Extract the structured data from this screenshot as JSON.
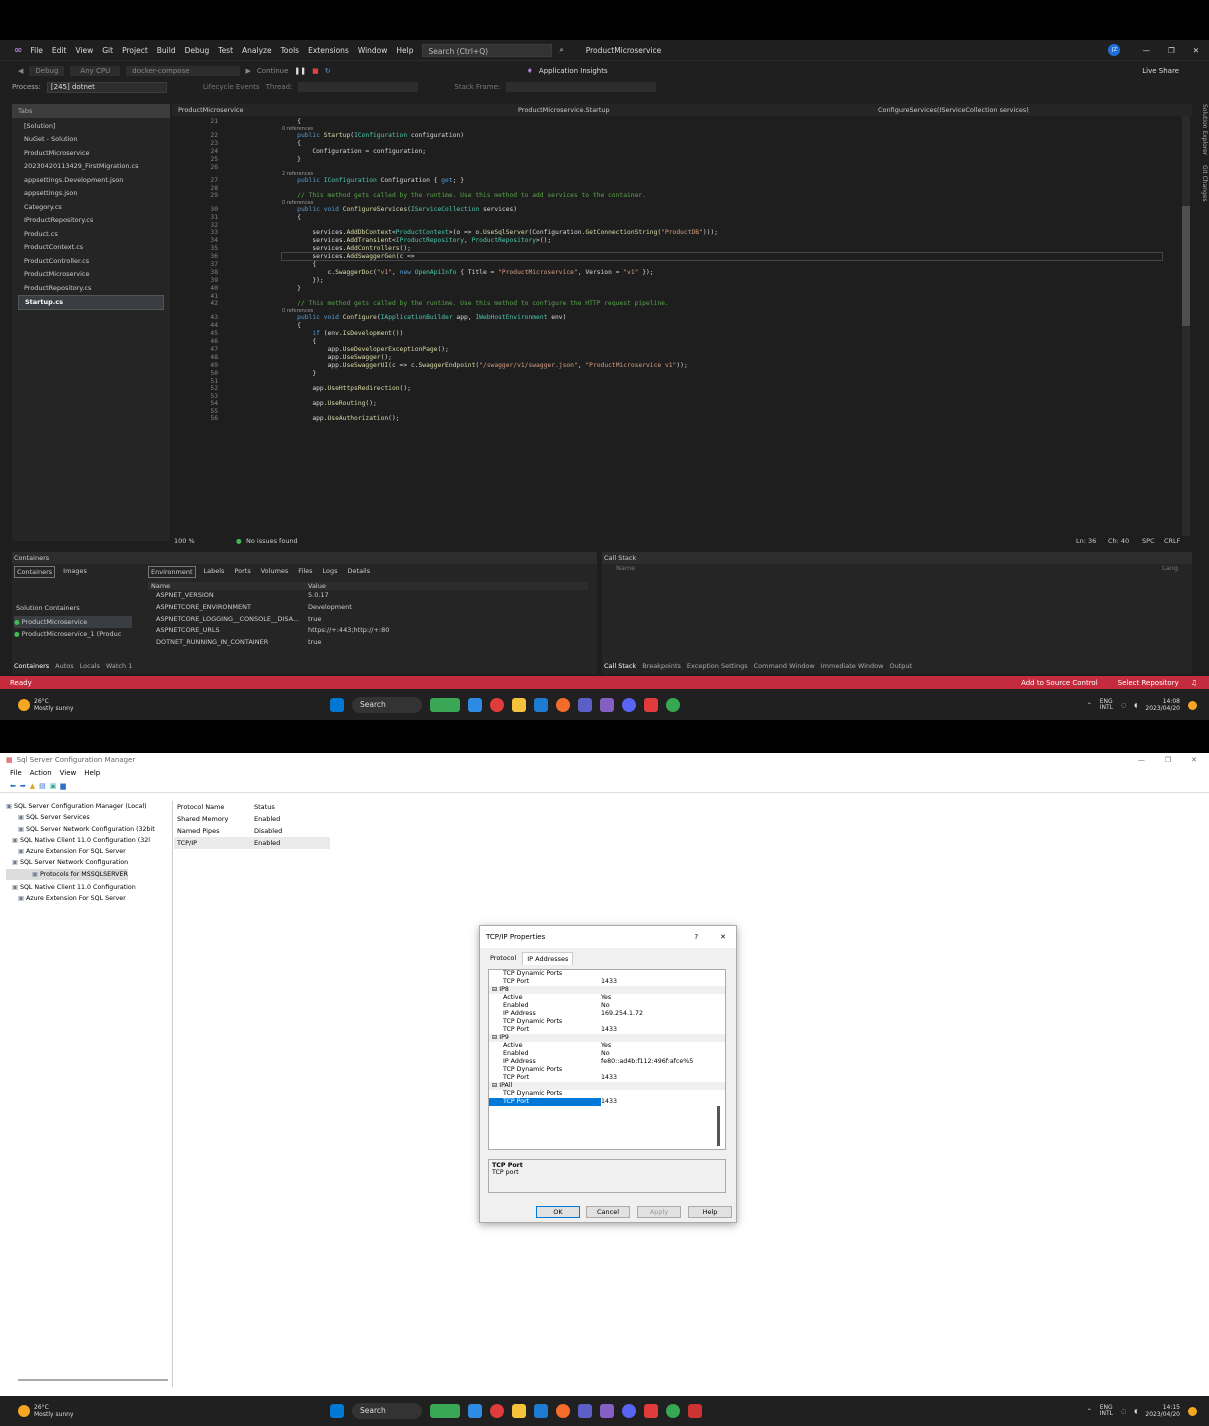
{
  "vs": {
    "menu": [
      "File",
      "Edit",
      "View",
      "Git",
      "Project",
      "Build",
      "Debug",
      "Test",
      "Analyze",
      "Tools",
      "Extensions",
      "Window",
      "Help"
    ],
    "search_placeholder": "Search (Ctrl+Q)",
    "solution_name": "ProductMicroservice",
    "avatar": "JZ",
    "live_share": "Live Share",
    "toolbar": {
      "config": "Debug",
      "platform": "Any CPU",
      "profile": "docker-compose",
      "continue": "Continue",
      "app_insights": "Application Insights"
    },
    "process_label": "Process:",
    "process_value": "[245] dotnet",
    "lifecycle": "Lifecycle Events",
    "thread": "Thread:",
    "stack_frame": "Stack Frame:",
    "tabs_header": "Tabs",
    "solution_files": [
      "[Solution]",
      "NuGet - Solution",
      "ProductMicroservice",
      "20230420113429_FirstMigration.cs",
      "appsettings.Development.json",
      "appsettings.json",
      "Category.cs",
      "IProductRepository.cs",
      "Product.cs",
      "ProductContext.cs",
      "ProductController.cs",
      "ProductMicroservice",
      "ProductRepository.cs",
      "Startup.cs"
    ],
    "editor_tab": "ProductMicroservice",
    "nav_class": "ProductMicroservice.Startup",
    "nav_member": "ConfigureServices(IServiceCollection services)",
    "side_tabs": [
      "Solution Explorer",
      "Git Changes"
    ],
    "code_lines": [
      {
        "n": "21",
        "t": "    {"
      },
      {
        "n": "22",
        "r": "0 references",
        "t": "    public Startup(IConfiguration configuration)"
      },
      {
        "n": "23",
        "t": "    {"
      },
      {
        "n": "24",
        "t": "        Configuration = configuration;"
      },
      {
        "n": "25",
        "t": "    }"
      },
      {
        "n": "26",
        "t": ""
      },
      {
        "n": "27",
        "r": "2 references",
        "t": "    public IConfiguration Configuration { get; }"
      },
      {
        "n": "28",
        "t": ""
      },
      {
        "n": "29",
        "t": "    // This method gets called by the runtime. Use this method to add services to the container."
      },
      {
        "n": "30",
        "r": "0 references",
        "t": "    public void ConfigureServices(IServiceCollection services)"
      },
      {
        "n": "31",
        "t": "    {"
      },
      {
        "n": "32",
        "t": ""
      },
      {
        "n": "33",
        "t": "        services.AddDbContext<ProductContext>(o => o.UseSqlServer(Configuration.GetConnectionString(\"ProductDB\")));"
      },
      {
        "n": "34",
        "t": "        services.AddTransient<IProductRepository, ProductRepository>();"
      },
      {
        "n": "35",
        "t": "        services.AddControllers();"
      },
      {
        "n": "36",
        "t": "        services.AddSwaggerGen(c =>"
      },
      {
        "n": "37",
        "t": "        {"
      },
      {
        "n": "38",
        "t": "            c.SwaggerDoc(\"v1\", new OpenApiInfo { Title = \"ProductMicroservice\", Version = \"v1\" });"
      },
      {
        "n": "39",
        "t": "        });"
      },
      {
        "n": "40",
        "t": "    }"
      },
      {
        "n": "41",
        "t": ""
      },
      {
        "n": "42",
        "t": "    // This method gets called by the runtime. Use this method to configure the HTTP request pipeline."
      },
      {
        "n": "43",
        "r": "0 references",
        "t": "    public void Configure(IApplicationBuilder app, IWebHostEnvironment env)"
      },
      {
        "n": "44",
        "t": "    {"
      },
      {
        "n": "45",
        "t": "        if (env.IsDevelopment())"
      },
      {
        "n": "46",
        "t": "        {"
      },
      {
        "n": "47",
        "t": "            app.UseDeveloperExceptionPage();"
      },
      {
        "n": "48",
        "t": "            app.UseSwagger();"
      },
      {
        "n": "49",
        "t": "            app.UseSwaggerUI(c => c.SwaggerEndpoint(\"/swagger/v1/swagger.json\", \"ProductMicroservice v1\"));"
      },
      {
        "n": "50",
        "t": "        }"
      },
      {
        "n": "51",
        "t": ""
      },
      {
        "n": "52",
        "t": "        app.UseHttpsRedirection();"
      },
      {
        "n": "53",
        "t": ""
      },
      {
        "n": "54",
        "t": "        app.UseRouting();"
      },
      {
        "n": "55",
        "t": ""
      },
      {
        "n": "56",
        "t": "        app.UseAuthorization();"
      }
    ],
    "zoom": "100 %",
    "issues": "No issues found",
    "cursor": "Ln: 36",
    "col": "Ch: 40",
    "spc": "SPC",
    "eol": "CRLF",
    "containers": {
      "title": "Containers",
      "left_tabs": [
        "Containers",
        "Images"
      ],
      "detail_tabs": [
        "Environment",
        "Labels",
        "Ports",
        "Volumes",
        "Files",
        "Logs",
        "Details"
      ],
      "solution_containers": "Solution Containers",
      "items": [
        "ProductMicroservice",
        "ProductMicroservice_1 (Produc"
      ],
      "col_name": "Name",
      "col_value": "Value",
      "env": [
        [
          "ASPNET_VERSION",
          "5.0.17"
        ],
        [
          "ASPNETCORE_ENVIRONMENT",
          "Development"
        ],
        [
          "ASPNETCORE_LOGGING__CONSOLE__DISA...",
          "true"
        ],
        [
          "ASPNETCORE_URLS",
          "https://+:443;http://+:80"
        ],
        [
          "DOTNET_RUNNING_IN_CONTAINER",
          "true"
        ]
      ],
      "bottom_tabs": [
        "Containers",
        "Autos",
        "Locals",
        "Watch 1"
      ]
    },
    "callstack": {
      "title": "Call Stack",
      "col_name": "Name",
      "col_lang": "Lang",
      "bottom_tabs": [
        "Call Stack",
        "Breakpoints",
        "Exception Settings",
        "Command Window",
        "Immediate Window",
        "Output"
      ]
    },
    "status": {
      "ready": "Ready",
      "source_control": "Add to Source Control",
      "repo": "Select Repository"
    }
  },
  "taskbar": {
    "temp": "26°C",
    "weather": "Mostly sunny",
    "search": "Search",
    "lang": "ENG",
    "region": "INTL",
    "time1": "14:08",
    "date": "2023/04/20",
    "time2": "14:15"
  },
  "sql": {
    "title": "Sql Server Configuration Manager",
    "menu": [
      "File",
      "Action",
      "View",
      "Help"
    ],
    "tree": [
      "SQL Server Configuration Manager (Local)",
      "SQL Server Services",
      "SQL Server Network Configuration (32bit",
      "SQL Native Client 11.0 Configuration (32l",
      "Azure Extension For SQL Server",
      "SQL Server Network Configuration",
      "Protocols for MSSQLSERVER",
      "SQL Native Client 11.0 Configuration",
      "Azure Extension For SQL Server"
    ],
    "col_protocol": "Protocol Name",
    "col_status": "Status",
    "protocols": [
      [
        "Shared Memory",
        "Enabled"
      ],
      [
        "Named Pipes",
        "Disabled"
      ],
      [
        "TCP/IP",
        "Enabled"
      ]
    ]
  },
  "dialog": {
    "title": "TCP/IP Properties",
    "help": "?",
    "close": "✕",
    "tabs": [
      "Protocol",
      "IP Addresses"
    ],
    "rows": [
      {
        "k": "TCP Dynamic Ports",
        "v": ""
      },
      {
        "k": "TCP Port",
        "v": "1433"
      },
      {
        "k": "IP8",
        "v": "",
        "cat": true
      },
      {
        "k": "Active",
        "v": "Yes"
      },
      {
        "k": "Enabled",
        "v": "No"
      },
      {
        "k": "IP Address",
        "v": "169.254.1.72"
      },
      {
        "k": "TCP Dynamic Ports",
        "v": ""
      },
      {
        "k": "TCP Port",
        "v": "1433"
      },
      {
        "k": "IP9",
        "v": "",
        "cat": true
      },
      {
        "k": "Active",
        "v": "Yes"
      },
      {
        "k": "Enabled",
        "v": "No"
      },
      {
        "k": "IP Address",
        "v": "fe80::ad4b:f112:496f:afce%5"
      },
      {
        "k": "TCP Dynamic Ports",
        "v": ""
      },
      {
        "k": "TCP Port",
        "v": "1433"
      },
      {
        "k": "IPAll",
        "v": "",
        "cat": true
      },
      {
        "k": "TCP Dynamic Ports",
        "v": ""
      },
      {
        "k": "TCP Port",
        "v": "1433",
        "sel": true
      }
    ],
    "desc_title": "TCP Port",
    "desc": "TCP port",
    "ok": "OK",
    "cancel": "Cancel",
    "apply": "Apply",
    "helpbtn": "Help"
  }
}
